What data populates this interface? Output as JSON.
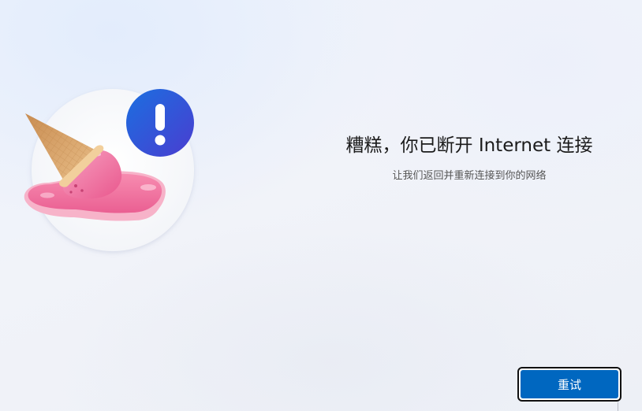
{
  "page": {
    "title": "糟糕，你已断开 Internet 连接",
    "subtitle": "让我们返回并重新连接到你的网络"
  },
  "illustration": {
    "name": "melted-ice-cream-cone",
    "badge_icon": "exclamation-icon",
    "colors": {
      "badge": "#3a52d6",
      "ice_cream": "#f06a9a",
      "cone": "#d9a66d"
    }
  },
  "actions": {
    "retry_label": "重试"
  },
  "colors": {
    "accent": "#0067c0",
    "focus_border": "#111111"
  }
}
